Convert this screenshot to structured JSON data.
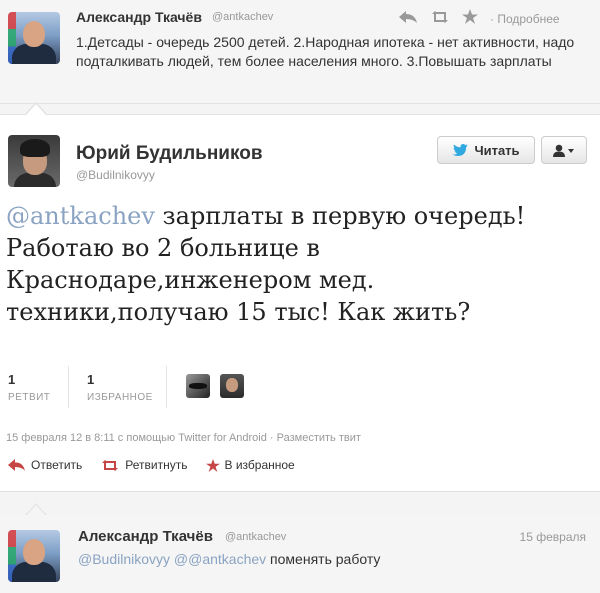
{
  "top_tweet": {
    "author_name": "Александр Ткачёв",
    "author_handle": "@antkachev",
    "text": "1.Детсады - очередь 2500 детей. 2.Народная ипотека - нет активности, надо подталкивать людей, тем более населения много. 3.Повышать зарплаты",
    "detail_label": "· Подробнее",
    "icons": [
      "reply-icon",
      "retweet-icon",
      "favorite-icon"
    ]
  },
  "main_tweet": {
    "author_name": "Юрий Будильников",
    "author_handle": "@Budilnikovyy",
    "follow_label": "Читать",
    "mention": "@antkachev",
    "text": " зарплаты в первую очередь! Работаю во 2 больнице в Краснодаре,инженером мед. техники,получаю 15 тыс! Как жить?",
    "retweets": {
      "count": "1",
      "label": "РЕТВИТ"
    },
    "favorites": {
      "count": "1",
      "label": "ИЗБРАННОЕ"
    },
    "meta": "15 февраля 12 в 8:11 с помощью Twitter for Android · Разместить твит",
    "actions": {
      "reply": "Ответить",
      "retweet": "Ретвитнуть",
      "favorite": "В избранное"
    }
  },
  "bottom_tweet": {
    "author_name": "Александр Ткачёв",
    "author_handle": "@antkachev",
    "date": "15 февраля",
    "mention1": "@Budilnikovyy",
    "mention2": "@@antkachev",
    "text": " поменять работу"
  },
  "colors": {
    "link": "#8aa3c2",
    "muted": "#999999",
    "text": "#333333",
    "twitter_bird": "#2fa9e0",
    "star": "#c64646"
  }
}
